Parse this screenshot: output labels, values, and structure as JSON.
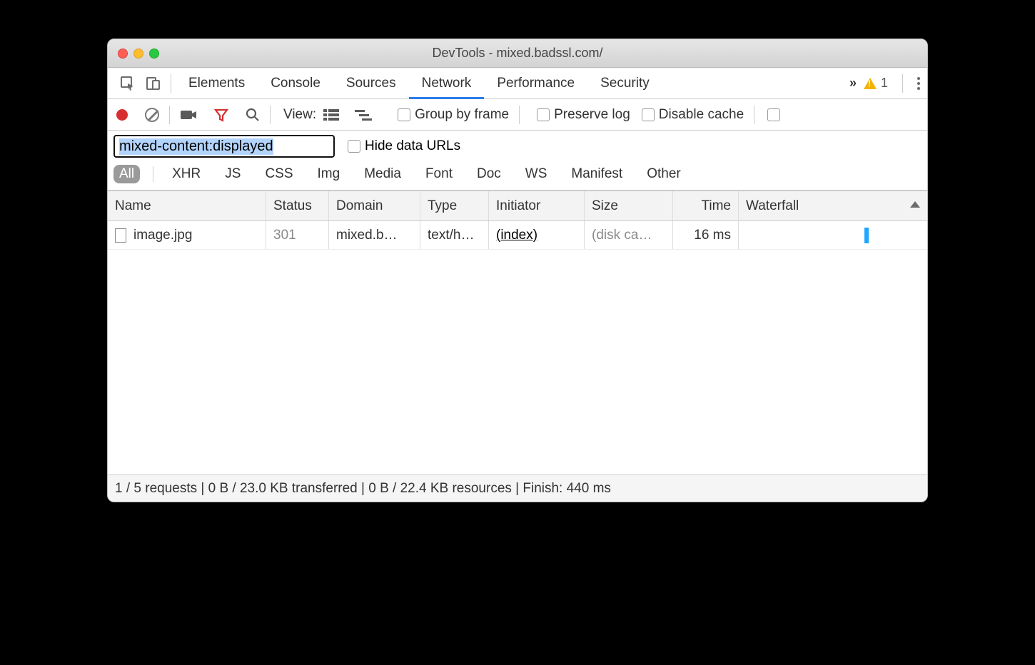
{
  "window": {
    "title": "DevTools - mixed.badssl.com/"
  },
  "tabs": {
    "items": [
      "Elements",
      "Console",
      "Sources",
      "Network",
      "Performance",
      "Security"
    ],
    "active": "Network",
    "overflow": "»",
    "warnings": {
      "count": "1"
    }
  },
  "toolbar": {
    "view_label": "View:",
    "group_by_frame": "Group by frame",
    "preserve_log": "Preserve log",
    "disable_cache": "Disable cache"
  },
  "filter": {
    "input_value": "mixed-content:displayed",
    "hide_data_urls": "Hide data URLs",
    "types": [
      "All",
      "XHR",
      "JS",
      "CSS",
      "Img",
      "Media",
      "Font",
      "Doc",
      "WS",
      "Manifest",
      "Other"
    ],
    "active_type": "All"
  },
  "table": {
    "columns": [
      "Name",
      "Status",
      "Domain",
      "Type",
      "Initiator",
      "Size",
      "Time",
      "Waterfall"
    ],
    "sort_column": "Waterfall",
    "sort_dir": "asc",
    "rows": [
      {
        "name": "image.jpg",
        "status": "301",
        "domain": "mixed.b…",
        "type": "text/h…",
        "initiator": "(index)",
        "size": "(disk ca…",
        "time": "16 ms"
      }
    ]
  },
  "status": {
    "text": "1 / 5 requests | 0 B / 23.0 KB transferred | 0 B / 22.4 KB resources | Finish: 440 ms"
  }
}
